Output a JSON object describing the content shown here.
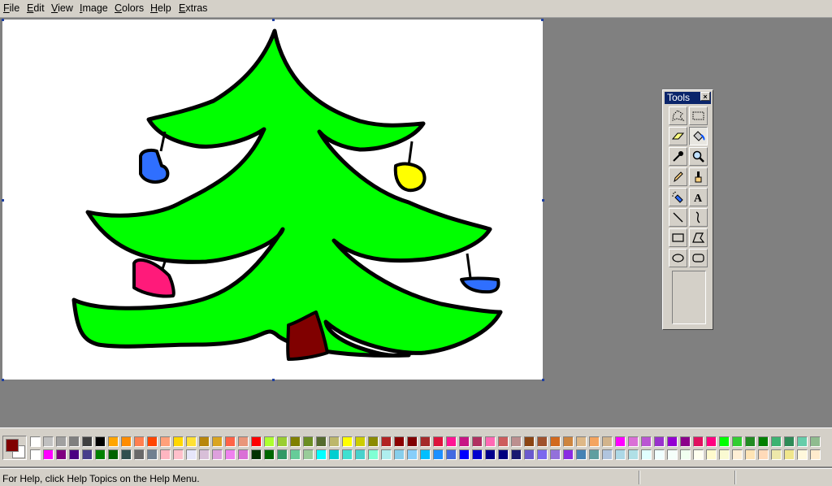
{
  "menu": {
    "file": "File",
    "edit": "Edit",
    "view": "View",
    "image": "Image",
    "colors": "Colors",
    "help": "Help",
    "extras": "Extras"
  },
  "toolbox": {
    "title": "Tools",
    "close": "×",
    "tools": [
      {
        "name": "free-form-select-icon"
      },
      {
        "name": "rect-select-icon"
      },
      {
        "name": "eraser-icon"
      },
      {
        "name": "fill-bucket-icon",
        "active": true
      },
      {
        "name": "color-picker-icon"
      },
      {
        "name": "magnifier-icon"
      },
      {
        "name": "pencil-icon"
      },
      {
        "name": "brush-icon"
      },
      {
        "name": "airbrush-icon"
      },
      {
        "name": "text-icon",
        "glyph": "A"
      },
      {
        "name": "line-icon"
      },
      {
        "name": "curve-icon"
      },
      {
        "name": "rectangle-icon"
      },
      {
        "name": "polygon-icon"
      },
      {
        "name": "ellipse-icon"
      },
      {
        "name": "rounded-rectangle-icon"
      }
    ]
  },
  "current_colors": {
    "foreground": "#800000",
    "background": "#ffffff"
  },
  "palette": {
    "row1": [
      "#ffffff",
      "#c0c0c0",
      "#a0a0a0",
      "#808080",
      "#404040",
      "#000000",
      "#ffa500",
      "#ff8c00",
      "#ff7f50",
      "#ff4500",
      "#ffa07a",
      "#ffd700",
      "#ffe135",
      "#b8860b",
      "#daa520",
      "#ff6347",
      "#e9967a",
      "#ff0000",
      "#adff2f",
      "#9acd32",
      "#808000",
      "#6b8e23",
      "#556b2f",
      "#bdb76b",
      "#ffff00",
      "#cdcd00",
      "#8b8b00",
      "#b22222",
      "#8b0000",
      "#800000",
      "#a52a2a",
      "#dc143c",
      "#ff1493",
      "#c71585",
      "#b03060",
      "#ff69b4",
      "#cd5c5c",
      "#bc8f8f",
      "#8b4513",
      "#a0522d",
      "#d2691e",
      "#cd853f",
      "#deb887",
      "#f4a460",
      "#d2b48c",
      "#ff00ff",
      "#da70d6",
      "#ba55d3",
      "#9932cc",
      "#9400d3",
      "#8b008b",
      "#e0115f",
      "#ff0080",
      "#00ff00",
      "#32cd32",
      "#228b22",
      "#008000",
      "#3cb371",
      "#2e8b57",
      "#66cdaa",
      "#8fbc8f",
      "#20b2aa",
      "#7cfc00",
      "#7fff00",
      "#90ee90",
      "#98fb98",
      "#00fa9a",
      "#00ff7f",
      "#a0522d",
      "#ff4040",
      "#e06666"
    ],
    "row2": [
      "#ffffff",
      "#ff00ff",
      "#800080",
      "#4b0082",
      "#483d8b",
      "#008000",
      "#006400",
      "#2f4f4f",
      "#696969",
      "#708090",
      "#ffb6c1",
      "#ffc0cb",
      "#e6e6fa",
      "#d8bfd8",
      "#dda0dd",
      "#ee82ee",
      "#da70d6",
      "#003300",
      "#006600",
      "#339966",
      "#66cc99",
      "#99cc99",
      "#00ffff",
      "#00ced1",
      "#40e0d0",
      "#48d1cc",
      "#7fffd4",
      "#afeeee",
      "#87ceeb",
      "#87cefa",
      "#00bfff",
      "#1e90ff",
      "#4169e1",
      "#0000ff",
      "#0000cd",
      "#00008b",
      "#000080",
      "#191970",
      "#6a5acd",
      "#7b68ee",
      "#9370db",
      "#8a2be2",
      "#4682b4",
      "#5f9ea0",
      "#b0c4de",
      "#add8e6",
      "#b0e0e6",
      "#e0ffff",
      "#f0ffff",
      "#f5fffa",
      "#f0fff0",
      "#fffff0",
      "#fffacd",
      "#fafad2",
      "#ffefd5",
      "#ffe4b5",
      "#ffdab9",
      "#eee8aa",
      "#f0e68c",
      "#fff8dc",
      "#ffebcd",
      "#ffe4c4",
      "#ffdead",
      "#f5deb3",
      "#faebd7",
      "#fdf5e6",
      "#faf0e6",
      "#fff5ee",
      "#fffafa",
      "#f8f8ff",
      "#f5f5f5"
    ]
  },
  "status": {
    "help_text": "For Help, click Help Topics on the Help Menu."
  }
}
